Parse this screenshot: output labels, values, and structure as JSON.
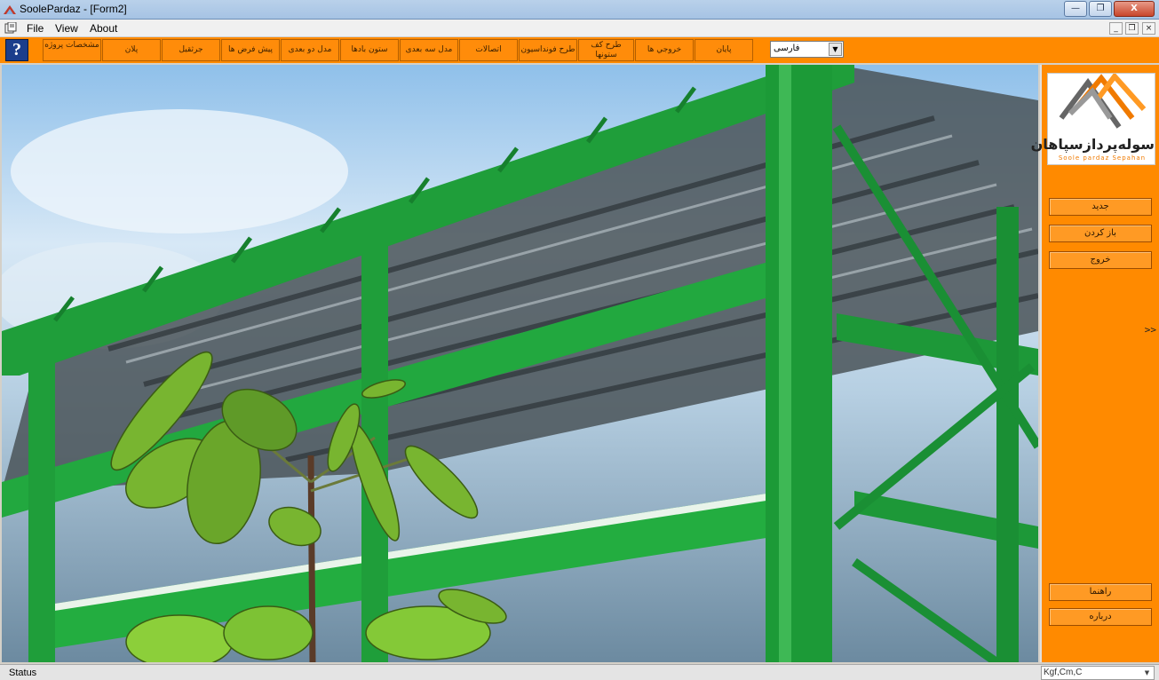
{
  "window": {
    "title": "SoolePardaz - [Form2]",
    "minimize_glyph": "—",
    "restore_glyph": "❐",
    "close_glyph": "X",
    "app_icon": "app-window-icon"
  },
  "menubar": {
    "items": [
      {
        "label": "File"
      },
      {
        "label": "View"
      },
      {
        "label": "About"
      }
    ],
    "mdi_minimize": "_",
    "mdi_restore": "❐",
    "mdi_close": "×"
  },
  "toolbar": {
    "help_label": "?",
    "buttons": [
      {
        "label": "مشخصات پروژه"
      },
      {
        "label": "پلان"
      },
      {
        "label": "جرثقیل"
      },
      {
        "label": "پیش فرض ها"
      },
      {
        "label": "مدل دو بعدی"
      },
      {
        "label": "ستون بادها"
      },
      {
        "label": "مدل سه بعدی"
      },
      {
        "label": "اتصالات"
      },
      {
        "label": "طرح فونداسیون"
      },
      {
        "label": "طرح کف ستونها"
      },
      {
        "label": "خروجي ها"
      },
      {
        "label": "پایان"
      }
    ],
    "language": "فارسی",
    "dropdown_glyph": "▼"
  },
  "sidepanel": {
    "logo_text": "سوله‌پردازسپاهان",
    "logo_sub": "Soole pardaz Sepahan",
    "new_label": "جدید",
    "open_label": "باز کردن",
    "exit_label": "خروج",
    "expander": ">>",
    "help_label": "راهنما",
    "about_label": "درباره"
  },
  "statusbar": {
    "status": "Status",
    "units": "Kgf,Cm,C",
    "dropdown_glyph": "▼"
  },
  "colors": {
    "accent": "#ff8a00",
    "steel_green": "#1f9e3a"
  }
}
